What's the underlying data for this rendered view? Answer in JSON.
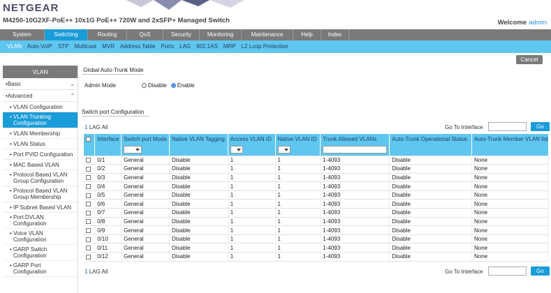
{
  "header": {
    "logo": "NETGEAR",
    "subtitle": "M4250-10G2XF-PoE++ 10x1G PoE++ 720W and 2xSFP+ Managed Switch",
    "welcome": "Welcome",
    "user": "admin"
  },
  "mainnav": [
    {
      "label": "System",
      "w": 64
    },
    {
      "label": "Switching",
      "w": 62,
      "active": true
    },
    {
      "label": "Routing",
      "w": 56
    },
    {
      "label": "QoS",
      "w": 52
    },
    {
      "label": "Security",
      "w": 52
    },
    {
      "label": "Monitoring",
      "w": 60
    },
    {
      "label": "Maintenance",
      "w": 74
    },
    {
      "label": "Help",
      "w": 40
    },
    {
      "label": "Index",
      "w": 40
    }
  ],
  "subnav": [
    "VLAN",
    "Auto-VoIP",
    "STP",
    "Multicast",
    "MVR",
    "Address Table",
    "Ports",
    "LAG",
    "802.1AS",
    "MRP",
    "L2 Loop Protection"
  ],
  "cancel_label": "Cancel",
  "sidebar": {
    "title": "VLAN",
    "groups": [
      {
        "label": "Basic",
        "chevron": "⌄"
      },
      {
        "label": "Advanced",
        "chevron": "⌃"
      }
    ],
    "items": [
      {
        "label": "VLAN Configuration",
        "lines": 1
      },
      {
        "label": "VLAN Trunking Configuration",
        "lines": 2,
        "active": true
      },
      {
        "label": "VLAN Membership",
        "lines": 1
      },
      {
        "label": "VLAN Status",
        "lines": 1
      },
      {
        "label": "Port PVID Configuration",
        "lines": 1
      },
      {
        "label": "MAC Based VLAN",
        "lines": 1
      },
      {
        "label": "Protocol Based VLAN Group Configuration",
        "lines": 2
      },
      {
        "label": "Protocol Based VLAN Group Membership",
        "lines": 2
      },
      {
        "label": "IP Subnet Based VLAN",
        "lines": 1
      },
      {
        "label": "Port DVLAN Configuration",
        "lines": 2
      },
      {
        "label": "Voice VLAN Configuration",
        "lines": 2
      },
      {
        "label": "GARP Switch Configuration",
        "lines": 2
      },
      {
        "label": "GARP Port Configuration",
        "lines": 2
      }
    ]
  },
  "global": {
    "title": "Global Auto-Trunk Mode",
    "admin_label": "Admin Mode",
    "disable_label": "Disable",
    "enable_label": "Enable",
    "selected": "Enable"
  },
  "switchport": {
    "title": "Switch port Configuration",
    "lag_num": "1",
    "lag_label": "LAG",
    "all_label": "All",
    "goto_label": "Go To Interface",
    "go_label": "Go",
    "columns": [
      "Interface",
      "Switch port Mode",
      "Native VLAN Tagging",
      "Access VLAN ID",
      "Native VLAN ID",
      "Trunk Allowed VLANs",
      "Auto-Trunk Operational Status",
      "Auto-Trunk Member VLAN list"
    ],
    "rows": [
      [
        "0/1",
        "General",
        "Disable",
        "1",
        "1",
        "1-4093",
        "Disable",
        "None"
      ],
      [
        "0/2",
        "General",
        "Disable",
        "1",
        "1",
        "1-4093",
        "Disable",
        "None"
      ],
      [
        "0/3",
        "General",
        "Disable",
        "1",
        "1",
        "1-4093",
        "Disable",
        "None"
      ],
      [
        "0/4",
        "General",
        "Disable",
        "1",
        "1",
        "1-4093",
        "Disable",
        "None"
      ],
      [
        "0/5",
        "General",
        "Disable",
        "1",
        "1",
        "1-4093",
        "Disable",
        "None"
      ],
      [
        "0/6",
        "General",
        "Disable",
        "1",
        "1",
        "1-4093",
        "Disable",
        "None"
      ],
      [
        "0/7",
        "General",
        "Disable",
        "1",
        "1",
        "1-4093",
        "Disable",
        "None"
      ],
      [
        "0/8",
        "General",
        "Disable",
        "1",
        "1",
        "1-4093",
        "Disable",
        "None"
      ],
      [
        "0/9",
        "General",
        "Disable",
        "1",
        "1",
        "1-4093",
        "Disable",
        "None"
      ],
      [
        "0/10",
        "General",
        "Disable",
        "1",
        "1",
        "1-4093",
        "Disable",
        "None"
      ],
      [
        "0/11",
        "General",
        "Disable",
        "1",
        "1",
        "1-4093",
        "Disable",
        "None"
      ],
      [
        "0/12",
        "General",
        "Disable",
        "1",
        "1",
        "1-4093",
        "Disable",
        "None"
      ]
    ]
  },
  "colors": {
    "accent": "#1a9cd8",
    "subnav": "#5fc6ef",
    "nav": "#7a7a7a"
  }
}
